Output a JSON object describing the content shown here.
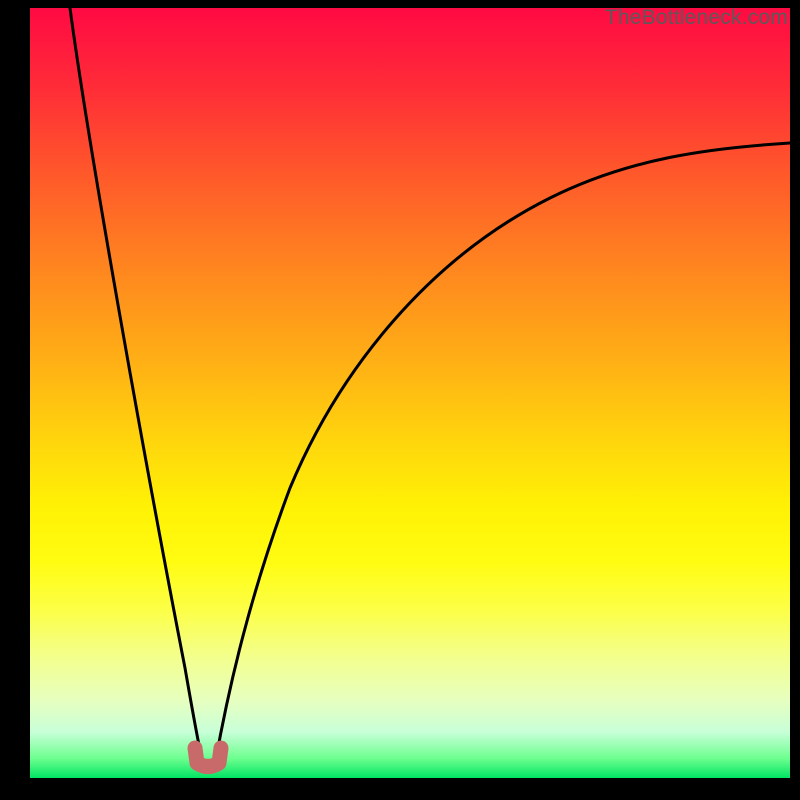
{
  "watermark": "TheBottleneck.com",
  "colors": {
    "frame_bg_top": "#ff0a43",
    "frame_bg_bottom": "#00e463",
    "curve": "#000000",
    "marker": "#c96a6a",
    "page_bg": "#000000",
    "watermark": "#5a5a5a"
  },
  "chart_data": {
    "type": "line",
    "title": "",
    "xlabel": "",
    "ylabel": "",
    "xlim": [
      0,
      100
    ],
    "ylim": [
      0,
      100
    ],
    "series": [
      {
        "name": "left-branch",
        "x": [
          5,
          7,
          9,
          11,
          13,
          15,
          17,
          19,
          20.5,
          22,
          22.7
        ],
        "values": [
          100,
          90,
          78,
          65,
          52,
          40,
          28,
          16,
          8,
          2,
          0
        ]
      },
      {
        "name": "right-branch",
        "x": [
          24.3,
          26,
          28,
          31,
          35,
          40,
          46,
          53,
          62,
          73,
          86,
          100
        ],
        "values": [
          0,
          4,
          12,
          22,
          33,
          43,
          52,
          60,
          67,
          73,
          78,
          82
        ]
      }
    ],
    "annotations": [
      {
        "name": "optimum-marker",
        "shape": "u",
        "x_range": [
          21.5,
          25.0
        ],
        "y_range": [
          0,
          3
        ],
        "color": "#c96a6a"
      }
    ]
  }
}
